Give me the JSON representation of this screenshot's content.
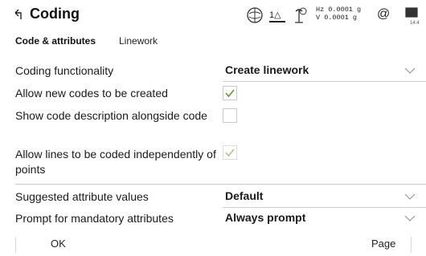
{
  "header": {
    "title": "Coding",
    "back_icon": "back-arrow-icon",
    "status": {
      "rtk_label": "1△",
      "hz": "Hz 0.0001 g",
      "v": "V  0.0001 g",
      "at_symbol": "@",
      "battery_label": "14:4"
    }
  },
  "tabs": [
    {
      "label": "Code & attributes",
      "active": true
    },
    {
      "label": "Linework",
      "active": false
    }
  ],
  "fields": {
    "coding_functionality": {
      "label": "Coding functionality",
      "value": "Create linework"
    },
    "allow_new_codes": {
      "label": "Allow new codes to be created",
      "checked": true
    },
    "show_code_description": {
      "label": "Show code description alongside code",
      "checked": false
    },
    "allow_lines_independent": {
      "label": "Allow lines to be coded independently of points",
      "checked": true,
      "disabled": true
    },
    "suggested_attribute_values": {
      "label": "Suggested attribute values",
      "value": "Default"
    },
    "prompt_mandatory": {
      "label": "Prompt for mandatory attributes",
      "value": "Always prompt"
    }
  },
  "footer": {
    "ok_label": "OK",
    "page_label": "Page"
  },
  "colors": {
    "check_active": "#5aa02c",
    "check_disabled": "#a8c88f",
    "divider": "#c8c8c8"
  }
}
